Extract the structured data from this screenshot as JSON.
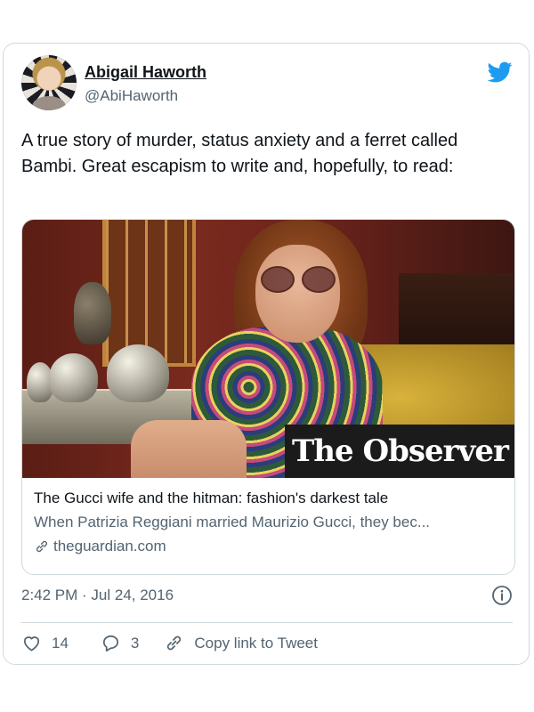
{
  "author": {
    "name": "Abigail Haworth",
    "handle": "@AbiHaworth"
  },
  "tweet": {
    "text": "A true story of murder, status anxiety and a ferret called Bambi. Great escapism to write and, hopefully, to read:"
  },
  "link_card": {
    "image_overlay": "The Observer",
    "title": "The Gucci wife and the hitman: fashion's darkest tale",
    "description": "When Patrizia Reggiani married Maurizio Gucci, they bec...",
    "domain": "theguardian.com"
  },
  "meta": {
    "timestamp": "2:42 PM · Jul 24, 2016"
  },
  "actions": {
    "likes": "14",
    "replies": "3",
    "copy_link": "Copy link to Tweet"
  },
  "colors": {
    "twitter_blue": "#1d9bf0",
    "secondary_text": "#536471",
    "border": "#cfd9de"
  },
  "icons": [
    "twitter-bird-icon",
    "link-icon",
    "info-icon",
    "heart-icon",
    "reply-icon",
    "copy-link-icon"
  ]
}
